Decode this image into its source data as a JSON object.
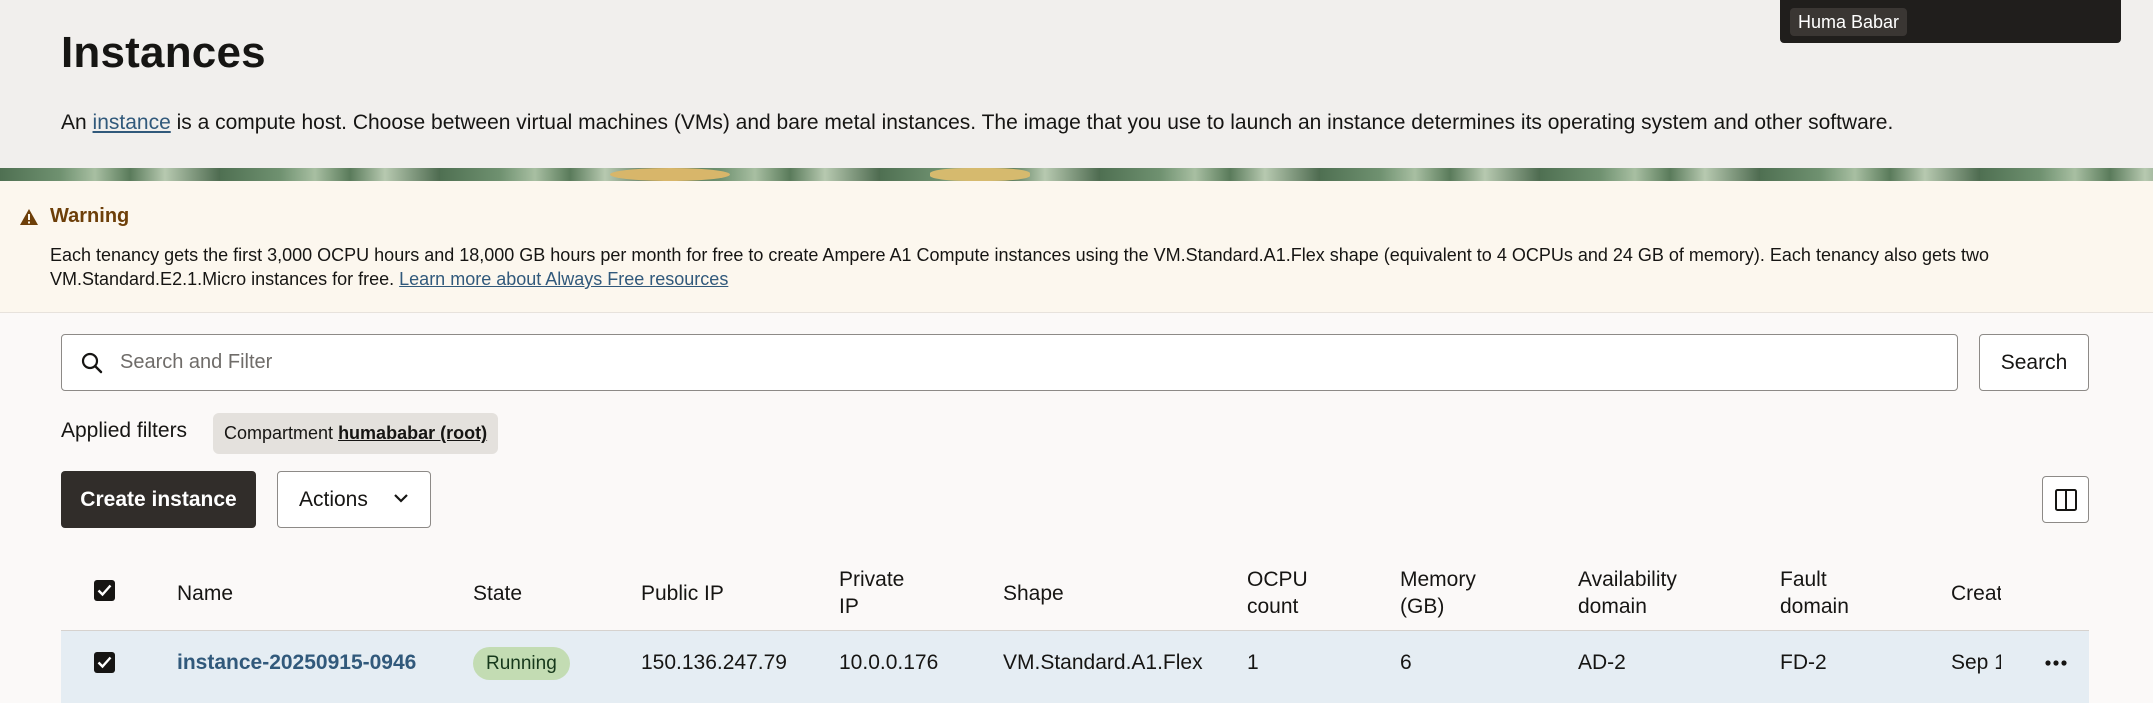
{
  "header": {
    "title": "Instances",
    "desc_prefix": "An ",
    "desc_link": "instance",
    "desc_suffix": " is a compute host. Choose between virtual machines (VMs) and bare metal instances. The image that you use to launch an instance determines its operating system and other software."
  },
  "user": {
    "name": "Huma Babar"
  },
  "warning": {
    "title": "Warning",
    "text": "Each tenancy gets the first 3,000 OCPU hours and 18,000 GB hours per month for free to create Ampere A1 Compute instances using the VM.Standard.A1.Flex shape (equivalent to 4 OCPUs and 24 GB of memory). Each tenancy also gets two VM.Standard.E2.1.Micro instances for free. ",
    "link": "Learn more about Always Free resources"
  },
  "search": {
    "placeholder": "Search and Filter",
    "button": "Search"
  },
  "filters": {
    "label": "Applied filters",
    "chip_key": "Compartment",
    "chip_value": "humababar (root)"
  },
  "toolbar": {
    "create": "Create instance",
    "actions": "Actions"
  },
  "table": {
    "headers": {
      "name": "Name",
      "state": "State",
      "public_ip": "Public IP",
      "private_ip_1": "Private",
      "private_ip_2": "IP",
      "shape": "Shape",
      "ocpu_1": "OCPU",
      "ocpu_2": "count",
      "memory_1": "Memory",
      "memory_2": "(GB)",
      "ad_1": "Availability",
      "ad_2": "domain",
      "fd_1": "Fault",
      "fd_2": "domain",
      "created": "Creat"
    },
    "rows": [
      {
        "name": "instance-20250915-0946",
        "state": "Running",
        "public_ip": "150.136.247.79",
        "private_ip": "10.0.0.176",
        "shape": "VM.Standard.A1.Flex",
        "ocpu": "1",
        "memory": "6",
        "ad": "AD-2",
        "fd": "FD-2",
        "created": "Sep 1"
      }
    ]
  },
  "colors": {
    "accent_link": "#31597b",
    "primary_button": "#312d2a",
    "row_selected": "#e5edf3",
    "running_badge": "#c3dcb3",
    "warning_title": "#6d3f09"
  },
  "icons": [
    "warning-icon",
    "search-icon",
    "chevron-down-icon",
    "columns-icon",
    "checkbox-checked-icon",
    "more-actions-icon"
  ]
}
